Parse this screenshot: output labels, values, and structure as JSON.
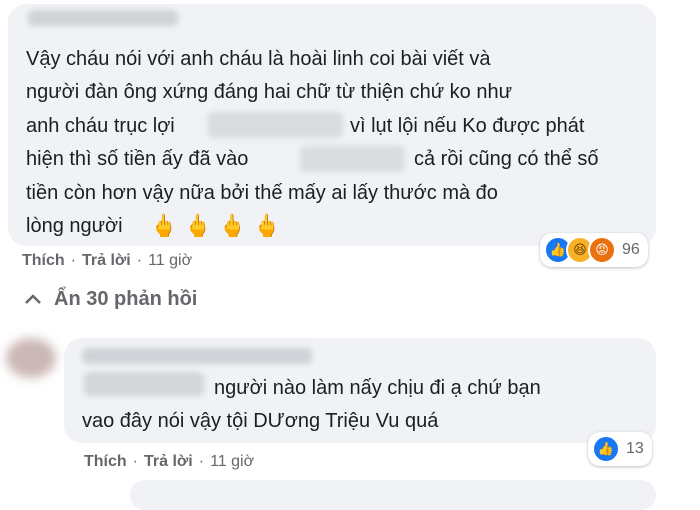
{
  "comment1": {
    "lines": [
      "Vậy cháu nói với anh cháu là hoài linh coi bài viết và",
      "người đàn ông xứng đáng hai chữ từ thiện chứ ko như",
      "anh cháu trục lợi",
      "vì lụt lội nếu Ko được phát",
      "hiện thì số tiền ấy đã vào",
      "cả rồi cũng có thể số",
      "tiền còn hơn vậy nữa bởi thế mấy ai lấy thước mà đo",
      "lòng người"
    ],
    "emoji": "🖕",
    "reaction_icons": [
      "like-icon",
      "haha-icon",
      "angry-icon"
    ],
    "reaction_count": "96",
    "like_label": "Thích",
    "reply_label": "Trả lời",
    "time": "11 giờ"
  },
  "replies_toggle": "Ẩn 30 phản hồi",
  "reply1": {
    "lines": [
      "người nào làm nấy chịu đi ạ chứ bạn",
      "vao đây nói vậy tội DƯơng Triệu Vu quá"
    ],
    "reaction_icons": [
      "like-icon"
    ],
    "reaction_count": "13",
    "like_label": "Thích",
    "reply_label": "Trả lời",
    "time": "11 giờ"
  }
}
